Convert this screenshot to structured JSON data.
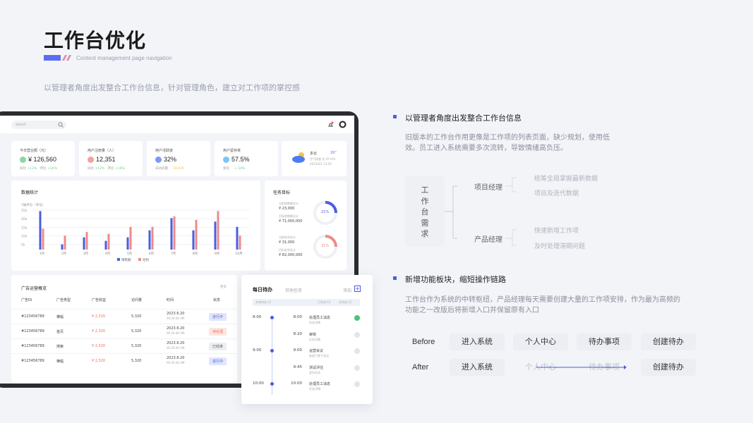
{
  "header": {
    "title": "工作台优化",
    "subtitle_en": "Content management page navigation",
    "lead": "以管理者角度出发整合工作台信息，针对管理角色，建立对工作项的掌控感"
  },
  "dashboard": {
    "search_placeholder": "search",
    "kpis": [
      {
        "label": "今日营业额（元）",
        "value": "¥ 126,560",
        "sub1": "同比",
        "sub1v": "+12%",
        "sub2": "环比",
        "sub2v": "+16%",
        "color": "#6ccf8a"
      },
      {
        "label": "用户注册量（人）",
        "value": "12,351",
        "sub1": "同比",
        "sub1v": "+12%",
        "sub2": "环比",
        "sub2v": "+16%",
        "color": "#f08a8a"
      },
      {
        "label": "用户活跃度",
        "value": "32%",
        "sub1": "日访问量",
        "sub1v": "",
        "sub2": "",
        "sub2v": "30,026",
        "color": "#5b7ff2"
      },
      {
        "label": "用户留存率",
        "value": "57.5%",
        "sub1": "变化",
        "sub1v": "",
        "sub2": "",
        "sub2v": "+ 10%",
        "color": "#5bb9f2"
      }
    ],
    "weather": {
      "city": "多云",
      "temp": "26°",
      "line1": "空气质量 优 29 AQI",
      "line2": "2023/6/1 13:56"
    },
    "stats": {
      "title": "数据统计",
      "unit": "Y轴单位（单位）",
      "yticks": [
        "25k",
        "20k",
        "15k",
        "10k",
        "5k"
      ],
      "legend": [
        "销售额",
        "毛利"
      ]
    },
    "goals": {
      "title": "任务目标",
      "items": [
        {
          "l1": "当前销售额总计",
          "v1": "¥ 23,000",
          "l2": "目标销售额总计",
          "v2": "¥ 71,000,000",
          "pct": "21%",
          "color": "#4a5ee0"
        },
        {
          "l1": "当前毛利总计",
          "v1": "¥ 31,000",
          "l2": "目标毛利总计",
          "v2": "¥ 82,000,000",
          "pct": "31%",
          "color": "#f08a8a"
        }
      ]
    },
    "ads": {
      "title": "广告运营概览",
      "more": "更多",
      "headers": [
        "广告ID",
        "广告类型",
        "广告收益",
        "访问量",
        "时间",
        "状态"
      ],
      "rows": [
        {
          "id": "#123456789",
          "type": "横幅",
          "rev": "¥ 2,320",
          "visits": "5,320",
          "date": "2023.6.20",
          "time": "00:26:46 AM",
          "status": "进行中",
          "sc": "#dfe5fb",
          "st": "#4a5ee0"
        },
        {
          "id": "#123456789",
          "type": "首页",
          "rev": "¥ 2,320",
          "visits": "5,320",
          "date": "2023.6.20",
          "time": "00:26:46 AM",
          "status": "待处理",
          "sc": "#fde5e2",
          "st": "#f0705f"
        },
        {
          "id": "#123456789",
          "type": "搜索",
          "rev": "¥ 2,320",
          "visits": "5,320",
          "date": "2023.6.20",
          "time": "00:26:46 AM",
          "status": "已结束",
          "sc": "#eceef2",
          "st": "#666"
        },
        {
          "id": "#123456789",
          "type": "横幅",
          "rev": "¥ 2,320",
          "visits": "5,320",
          "date": "2023.6.20",
          "time": "00:26:46 AM",
          "status": "进行中",
          "sc": "#dfe5fb",
          "st": "#4a5ee0"
        }
      ]
    }
  },
  "chart_data": {
    "type": "bar",
    "title": "数据统计",
    "ylabel": "Y轴单位（单位）",
    "categories": [
      "1月",
      "2月",
      "3月",
      "4月",
      "5月",
      "6月",
      "7月",
      "8月",
      "9月",
      "10月"
    ],
    "series": [
      {
        "name": "销售额",
        "values": [
          22,
          3,
          7,
          5,
          7,
          11,
          18,
          11,
          16,
          13
        ]
      },
      {
        "name": "毛利",
        "values": [
          12,
          8,
          10,
          9,
          13,
          13,
          19,
          17,
          22,
          8
        ]
      }
    ],
    "ylim": [
      0,
      25
    ]
  },
  "todo": {
    "title": "每日待办",
    "tab2": "其他任务",
    "add": "添加",
    "stats": [
      "未完待办:12",
      "已完成:12",
      "未完成:12"
    ],
    "times": [
      "8:00",
      "9:00",
      "10:00"
    ],
    "items": [
      {
        "time": "8:00",
        "title": "处理员工消息",
        "sub": "任务详情",
        "done": true
      },
      {
        "time": "8:20",
        "title": "审核",
        "sub": "任务详情",
        "done": false
      },
      {
        "time": "9:00",
        "title": "运营会议",
        "sub": "各部门线下会议",
        "done": false
      },
      {
        "time": "9:45",
        "title": "测试评估",
        "sub": "室内任务",
        "done": false
      },
      {
        "time": "10:00",
        "title": "处理员工消息",
        "sub": "任务详情",
        "done": false
      }
    ]
  },
  "right": {
    "s1": {
      "heading": "以管理者角度出发整合工作台信息",
      "para": "旧版本的工作台作用更像是工作项的列表页面，缺少规划，使用低效。员工进入系统需要多次流转，导致情绪高负压。"
    },
    "tree": {
      "root": "工作台需求",
      "branches": [
        {
          "name": "项目经理",
          "items": [
            "统筹全局掌握最新数据",
            "项目及迭代数据"
          ]
        },
        {
          "name": "产品经理",
          "items": [
            "快速新增工作项",
            "及时处理滞期问题"
          ]
        }
      ]
    },
    "s2": {
      "heading": "新增功能板块，缩短操作链路",
      "para": "工作台作为系统的中转枢纽，产品经理每天需要创建大量的工作项安排，作为最为高频的功能之一改版后将新增入口并保留原有入口"
    },
    "before": {
      "label": "Before",
      "steps": [
        "进入系统",
        "个人中心",
        "待办事项",
        "创建待办"
      ]
    },
    "after": {
      "label": "After",
      "steps": [
        "进入系统",
        "个人中心",
        "待办事项",
        "创建待办"
      ]
    }
  }
}
